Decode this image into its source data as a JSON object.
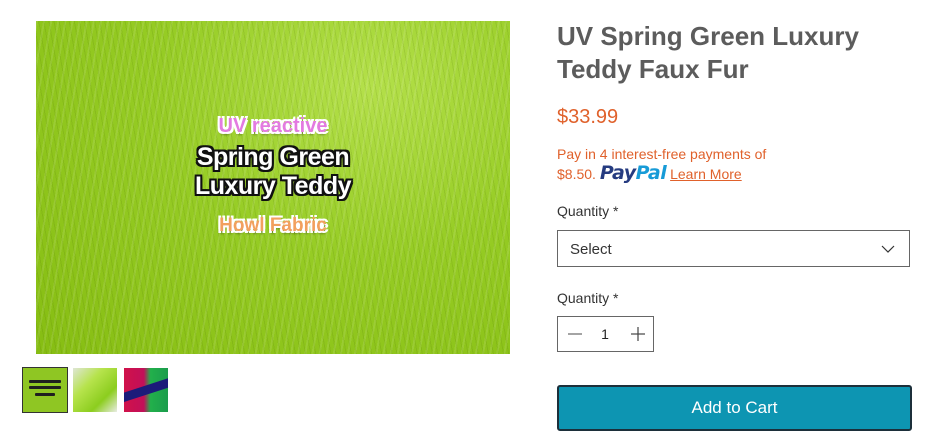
{
  "gallery": {
    "main_image": {
      "overlay_uv": "UV reactive",
      "overlay_line1": "Spring Green",
      "overlay_line2": "Luxury Teddy",
      "overlay_brand": "Howl Fabric"
    },
    "thumbnails_count": 3,
    "selected_thumbnail": 1
  },
  "product": {
    "title": "UV Spring Green Luxury Teddy Faux Fur",
    "price": "$33.99",
    "installment_text": "Pay in 4 interest-free payments of",
    "installment_amount": "$8.50.",
    "paypal_pay": "Pay",
    "paypal_pal": "Pal",
    "learn_more": "Learn More"
  },
  "options": {
    "quantity_select_label": "Quantity *",
    "quantity_select_value": "Select",
    "quantity_stepper_label": "Quantity *",
    "quantity_value": "1"
  },
  "actions": {
    "add_to_cart": "Add to Cart"
  },
  "colors": {
    "price_accent": "#e0612b",
    "cart_button": "#0d95b2",
    "title_text": "#5c5c5c",
    "fur_green": "#96cc24"
  }
}
